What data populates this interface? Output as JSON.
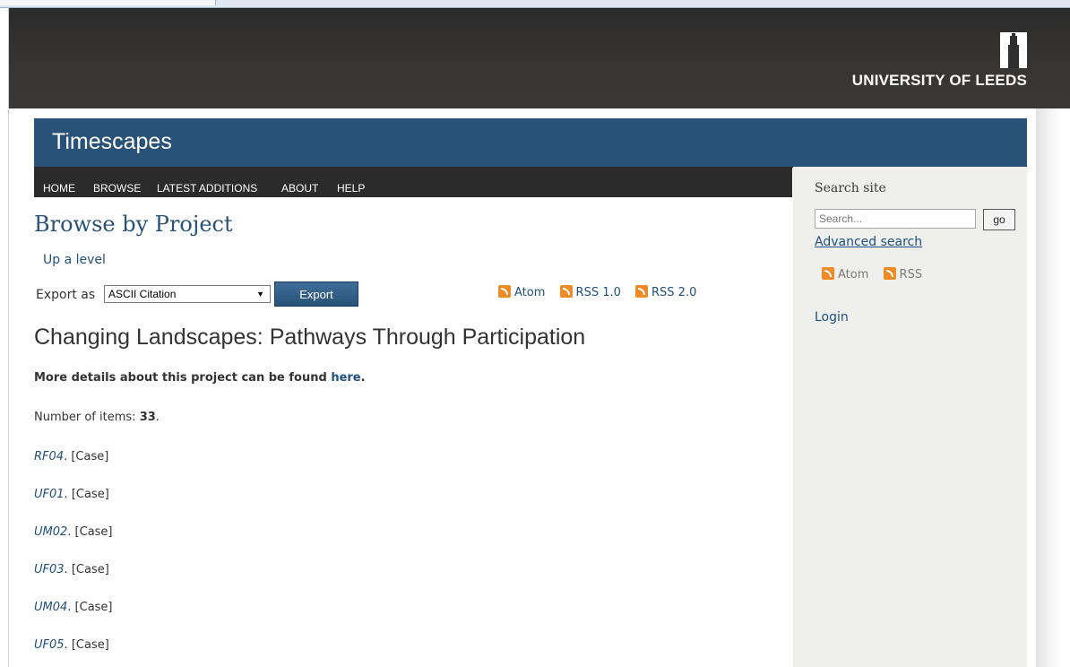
{
  "header": {
    "university": "UNIVERSITY OF LEEDS",
    "site_title": "Timescapes"
  },
  "nav": {
    "items": [
      "HOME",
      "BROWSE",
      "LATEST ADDITIONS",
      "ABOUT",
      "HELP"
    ]
  },
  "main": {
    "heading": "Browse by Project",
    "up_level": "Up a level",
    "export_label": "Export as",
    "export_selected": "ASCII Citation",
    "export_button": "Export",
    "feeds": [
      "Atom",
      "RSS 1.0",
      "RSS 2.0"
    ],
    "project_title": "Changing Landscapes: Pathways Through Participation",
    "details_text": "More details about this project can be found",
    "details_link": "here",
    "details_end": ".",
    "count_label": "Number of items:",
    "count_value": "33",
    "count_end": ".",
    "items": [
      {
        "id": "RF04",
        "type": "[Case]"
      },
      {
        "id": "UF01",
        "type": "[Case]"
      },
      {
        "id": "UM02",
        "type": "[Case]"
      },
      {
        "id": "UF03",
        "type": "[Case]"
      },
      {
        "id": "UM04",
        "type": "[Case]"
      },
      {
        "id": "UF05",
        "type": "[Case]"
      }
    ]
  },
  "sidebar": {
    "heading": "Search site",
    "search_placeholder": "Search...",
    "go_label": "go",
    "advanced": "Advanced search",
    "feeds": [
      "Atom",
      "RSS"
    ],
    "login": "Login"
  },
  "colors": {
    "title_bar": "#285277",
    "nav_bar": "#2b2b2b",
    "link": "#1f4f7e",
    "feed_icon": "#f08a24"
  }
}
